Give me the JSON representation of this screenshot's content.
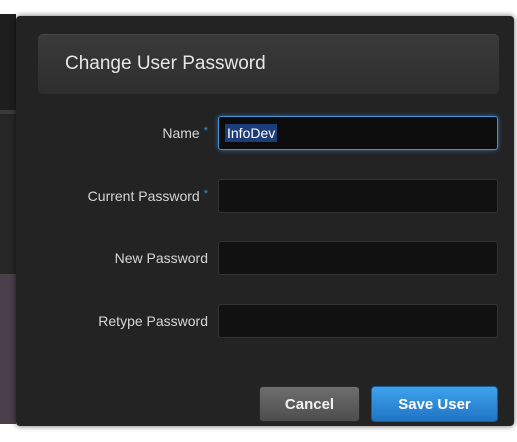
{
  "dialog": {
    "title": "Change User Password"
  },
  "form": {
    "name": {
      "label": "Name",
      "required_marker": "*",
      "value": "InfoDev"
    },
    "current_password": {
      "label": "Current Password",
      "required_marker": "*",
      "value": ""
    },
    "new_password": {
      "label": "New Password",
      "value": ""
    },
    "retype_password": {
      "label": "Retype Password",
      "value": ""
    }
  },
  "actions": {
    "cancel_label": "Cancel",
    "save_label": "Save User"
  },
  "colors": {
    "dialog_bg": "#232323",
    "header_bg": "#333333",
    "accent_blue": "#2e8fd6",
    "input_bg": "#111111",
    "cancel_button": "#5c5c5c",
    "save_button": "#2b86d8"
  }
}
